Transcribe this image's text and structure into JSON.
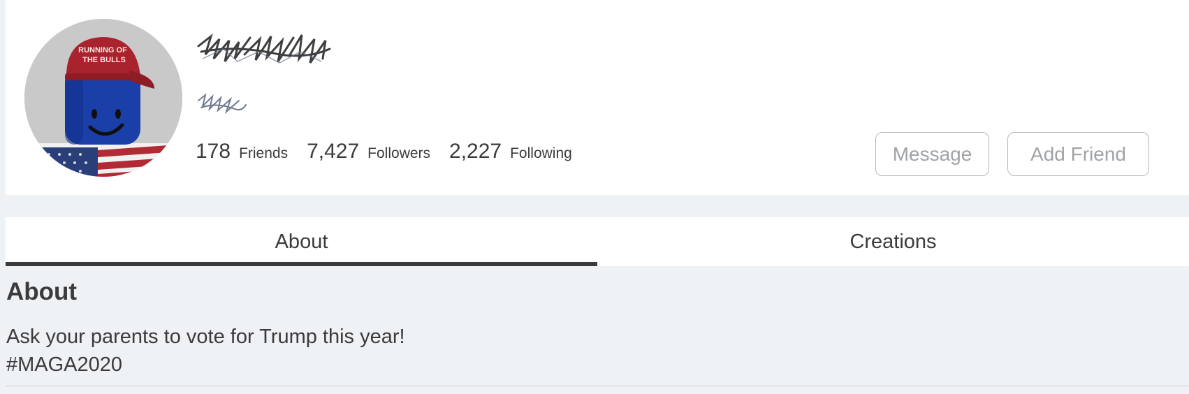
{
  "profile": {
    "stats": [
      {
        "count": "178",
        "label": "Friends"
      },
      {
        "count": "7,427",
        "label": "Followers"
      },
      {
        "count": "2,227",
        "label": "Following"
      }
    ],
    "avatar": {
      "hat_text_line1": "RUNNING OF",
      "hat_text_line2": "THE BULLS"
    }
  },
  "actions": {
    "message_label": "Message",
    "add_friend_label": "Add Friend"
  },
  "tabs": [
    {
      "label": "About",
      "active": true
    },
    {
      "label": "Creations",
      "active": false
    }
  ],
  "about": {
    "heading": "About",
    "bio_line1": "Ask your parents to vote for Trump this year!",
    "bio_line2": "#MAGA2020"
  },
  "colors": {
    "card_bg": "#ffffff",
    "page_bg": "#eff2f5",
    "text": "#393b3d",
    "button_text": "#a0a3a6",
    "hat_red": "#a8232d",
    "avatar_head_blue": "#1a3fa8"
  }
}
